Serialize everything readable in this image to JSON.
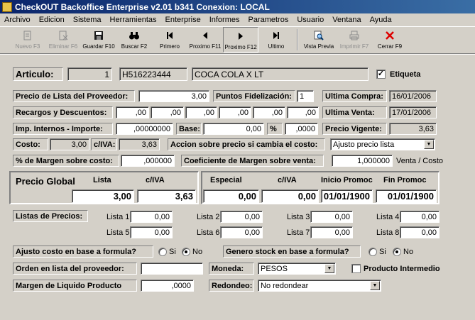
{
  "window": {
    "title": "CheckOUT Backoffice Enterprise v2.01 b341 Conexion: LOCAL"
  },
  "menu": [
    "Archivo",
    "Edicion",
    "Sistema",
    "Herramientas",
    "Enterprise",
    "Informes",
    "Parametros",
    "Usuario",
    "Ventana",
    "Ayuda"
  ],
  "toolbar": {
    "nuevo": "Nuevo F3",
    "eliminar": "Eliminar F6",
    "guardar": "Guardar F10",
    "buscar": "Buscar F2",
    "primero": "Primero",
    "proximo_f11": "Proximo F11",
    "proximo_f12": "Proximo F12",
    "ultimo": "Ultimo",
    "vista_previa": "Vista Previa",
    "imprimir": "Imprimir F7",
    "cerrar": "Cerrar F9"
  },
  "articulo": {
    "label": "Articulo:",
    "number": "1",
    "code": "H516223444",
    "description": "COCA COLA X LT",
    "etiqueta_label": "Etiqueta",
    "etiqueta_checked": "✓"
  },
  "precios": {
    "precio_lista_label": "Precio de Lista del Proveedor:",
    "precio_lista": "3,00",
    "puntos_label": "Puntos Fidelización:",
    "puntos": "1",
    "ultima_compra_label": "Ultima Compra:",
    "ultima_compra": "16/01/2006",
    "recargos_label": "Recargos y Descuentos:",
    "recargos": [
      ",00",
      ",00",
      ",00",
      ",00",
      ",00",
      ",00"
    ],
    "ultima_venta_label": "Ultima Venta:",
    "ultima_venta": "17/01/2006",
    "imp_internos_label": "Imp. Internos - Importe:",
    "imp_internos": ",00000000",
    "base_label": "Base:",
    "base": "0,00",
    "pct_label": "%",
    "pct": ",0000",
    "precio_vigente_label": "Precio Vigente:",
    "precio_vigente": "3,63",
    "costo_label": "Costo:",
    "costo": "3,00",
    "civa_label": "c/IVA:",
    "costo_civa": "3,63",
    "accion_label": "Accion sobre precio si cambia el costo:",
    "accion_value": "Ajusto precio lista",
    "margen_costo_label": "% de Margen sobre costo:",
    "margen_costo": ",000000",
    "coef_label": "Coeficiente de Margen sobre venta:",
    "coef": "1,000000",
    "venta_costo_label": "Venta / Costo"
  },
  "precio_global": {
    "label": "Precio Global",
    "lista_label": "Lista",
    "civa_label": "c/IVA",
    "lista": "3,00",
    "civa": "3,63",
    "especial_label": "Especial",
    "especial_civa_label": "c/IVA",
    "inicio_label": "Inicio Promoc",
    "fin_label": "Fin Promoc",
    "especial": "0,00",
    "especial_civa": "0,00",
    "inicio": "01/01/1900",
    "fin": "01/01/1900"
  },
  "listas": {
    "label": "Listas de Precios:",
    "items": [
      {
        "label": "Lista 1",
        "value": "0,00"
      },
      {
        "label": "Lista 2",
        "value": "0,00"
      },
      {
        "label": "Lista 3",
        "value": "0,00"
      },
      {
        "label": "Lista 4",
        "value": "0,00"
      },
      {
        "label": "Lista 5",
        "value": "0,00"
      },
      {
        "label": "Lista 6",
        "value": "0,00"
      },
      {
        "label": "Lista 7",
        "value": "0,00"
      },
      {
        "label": "Lista 8",
        "value": "0,00"
      }
    ]
  },
  "opciones": {
    "ajuste_label": "Ajusto costo en base a formula?",
    "genero_label": "Genero stock en base a formula?",
    "si": "Si",
    "no": "No",
    "orden_label": "Orden en lista del proveedor:",
    "orden": "",
    "moneda_label": "Moneda:",
    "moneda": "PESOS",
    "producto_intermedio_label": "Producto Intermedio",
    "margen_liquido_label": "Margen de Liquido Producto",
    "margen_liquido": ",0000",
    "redondeo_label": "Redondeo:",
    "redondeo": "No redondear"
  }
}
